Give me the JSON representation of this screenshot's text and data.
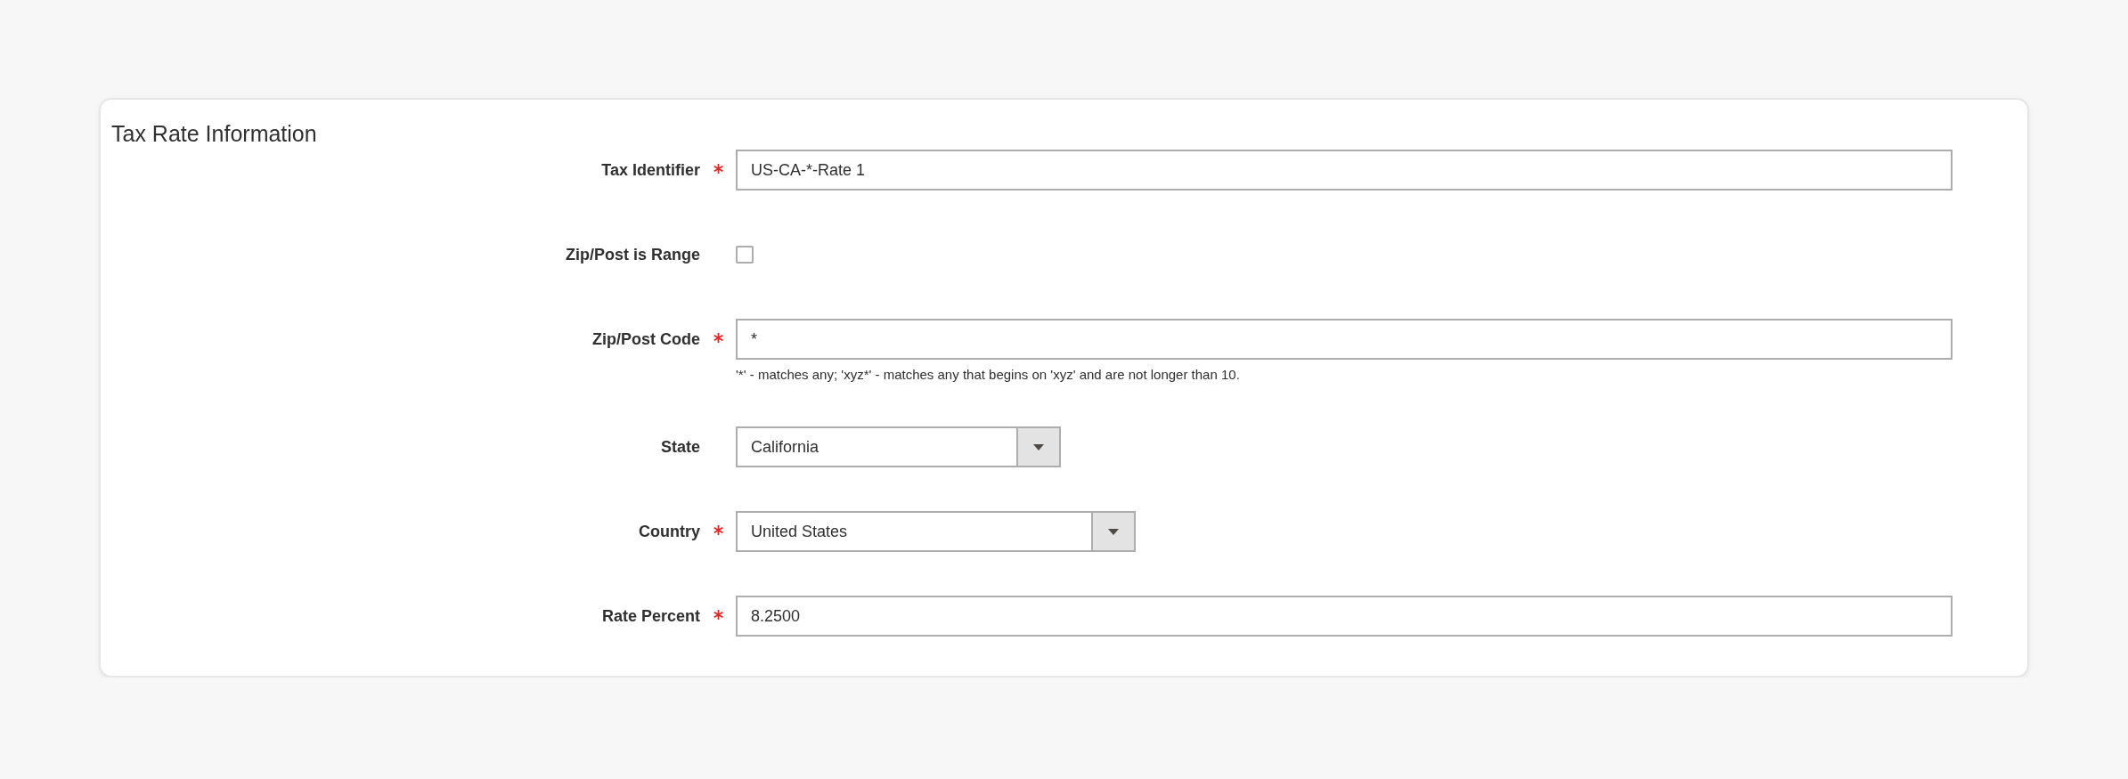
{
  "section": {
    "title": "Tax Rate Information"
  },
  "fields": [
    {
      "kind": "text",
      "label": "Tax Identifier",
      "required": true,
      "value": "US-CA-*-Rate 1"
    },
    {
      "kind": "checkbox",
      "label": "Zip/Post is Range",
      "required": false,
      "checked": false
    },
    {
      "kind": "text",
      "label": "Zip/Post Code",
      "required": true,
      "value": "*",
      "hint": "'*' - matches any; 'xyz*' - matches any that begins on 'xyz' and are not longer than 10."
    },
    {
      "kind": "select",
      "label": "State",
      "required": false,
      "value": "California"
    },
    {
      "kind": "select",
      "label": "Country",
      "required": true,
      "value": "United States"
    },
    {
      "kind": "text",
      "label": "Rate Percent",
      "required": true,
      "value": "8.2500"
    }
  ]
}
